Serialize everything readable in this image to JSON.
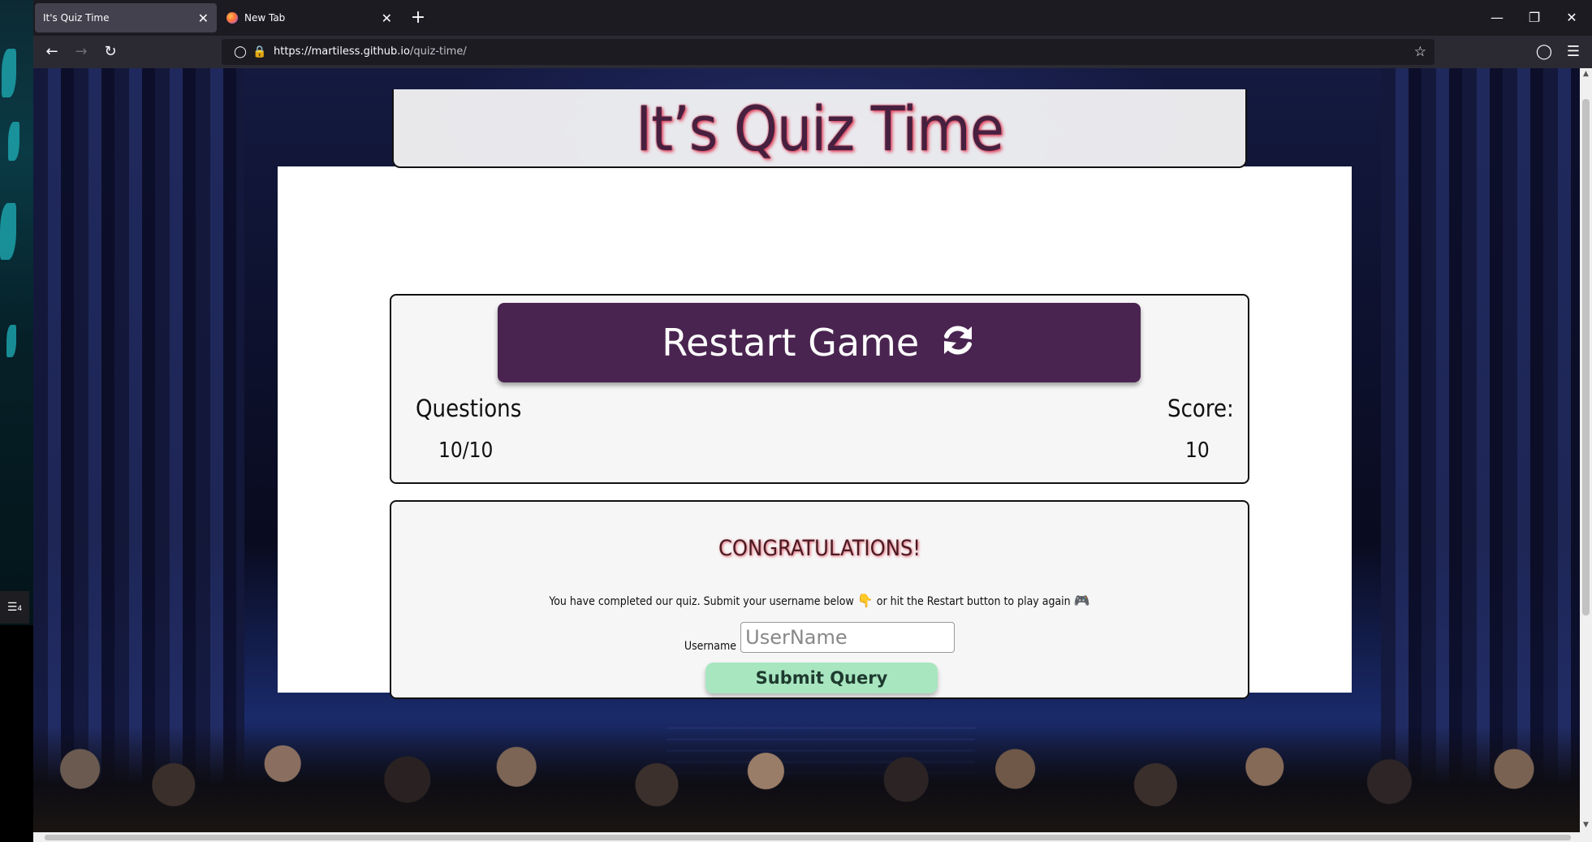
{
  "browser": {
    "tabs": [
      {
        "label": "It's Quiz Time",
        "active": true
      },
      {
        "label": "New Tab",
        "active": false
      }
    ],
    "url_host": "https://martiless.github.io",
    "url_path": "/quiz-time/"
  },
  "desktop": {
    "notification_count": "4"
  },
  "page": {
    "title": "It’s Quiz Time",
    "restart_label": "Restart Game",
    "questions_label": "Questions",
    "questions_value": "10/10",
    "score_label": "Score:",
    "score_value": "10",
    "congrats_heading": "CONGRATULATIONS!",
    "message_part1": "You have completed our quiz. Submit your username below",
    "message_part2": "or hit the Restart button to play again",
    "username_label": "Username",
    "username_placeholder": "UserName",
    "submit_label": "Submit Query"
  },
  "colors": {
    "restart_button": "#4a2450",
    "submit_button": "#a8e6c0",
    "title_text": "#47203f",
    "title_glow": "#e0405a"
  }
}
